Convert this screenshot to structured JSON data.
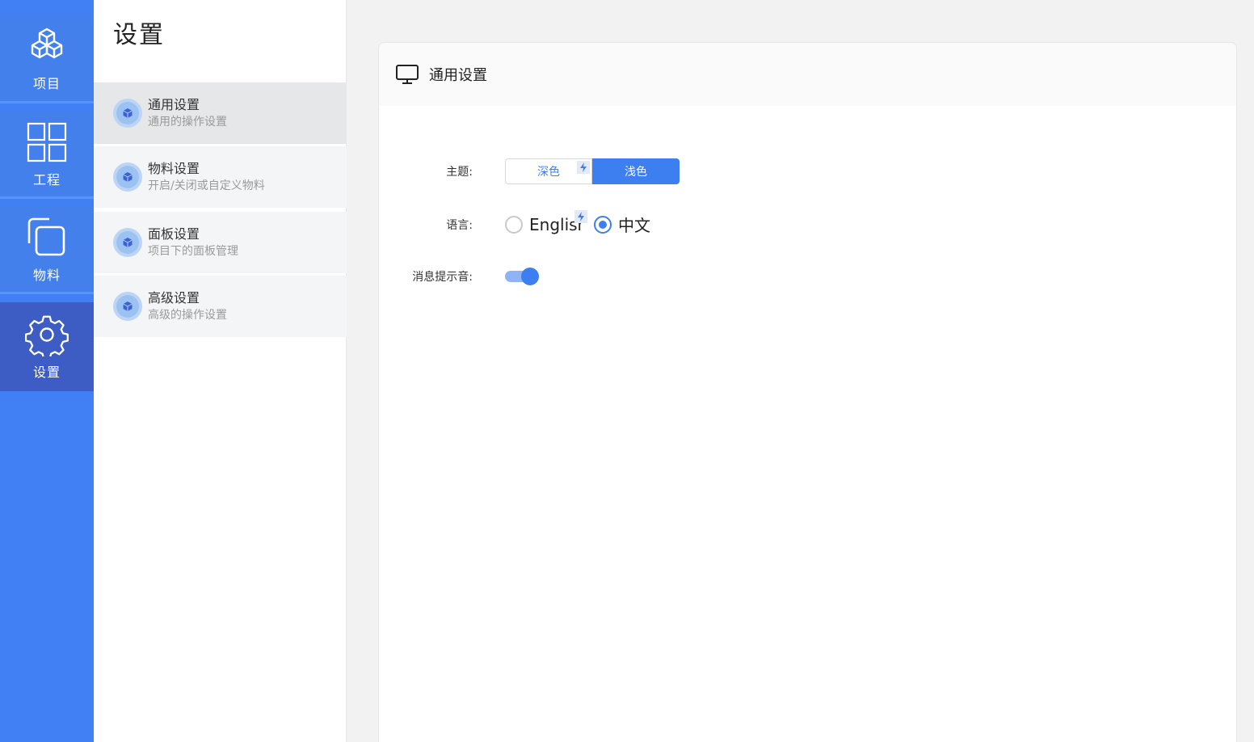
{
  "rail": {
    "items": [
      {
        "label": "项目",
        "icon": "cubes-icon"
      },
      {
        "label": "工程",
        "icon": "grid-icon"
      },
      {
        "label": "物料",
        "icon": "copy-icon"
      },
      {
        "label": "设置",
        "icon": "gear-icon"
      }
    ],
    "active": "设置"
  },
  "menu": {
    "title": "设置",
    "items": [
      {
        "name": "通用设置",
        "desc": "通用的操作设置",
        "active": true
      },
      {
        "name": "物料设置",
        "desc": "开启/关闭或自定义物料",
        "active": false
      },
      {
        "name": "面板设置",
        "desc": "项目下的面板管理",
        "active": false
      },
      {
        "name": "高级设置",
        "desc": "高级的操作设置",
        "active": false
      }
    ]
  },
  "panel": {
    "title": "通用设置",
    "icon": "monitor-icon",
    "theme": {
      "label": "主题:",
      "options": [
        "深色",
        "浅色"
      ],
      "selected": "浅色"
    },
    "language": {
      "label": "语言:",
      "options": [
        "English",
        "中文"
      ],
      "selected": "中文"
    },
    "sound": {
      "label": "消息提示音:",
      "enabled": true
    }
  },
  "colors": {
    "rail_bg": "#4080f4",
    "rail_active": "#3d5cc4",
    "accent": "#3d7ff0"
  }
}
